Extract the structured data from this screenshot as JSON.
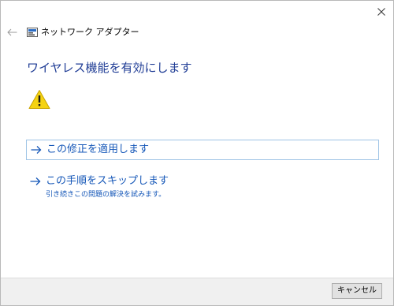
{
  "window": {
    "title": "ネットワーク アダプター"
  },
  "icons": {
    "back": "back-arrow-icon",
    "close": "close-icon",
    "app": "network-adapter-icon",
    "warning": "warning-icon",
    "option_arrow": "right-arrow-icon"
  },
  "main": {
    "heading": "ワイヤレス機能を有効にします"
  },
  "options": [
    {
      "label": "この修正を適用します",
      "description": ""
    },
    {
      "label": "この手順をスキップします",
      "description": "引き続きこの問題の解決を試みます。"
    }
  ],
  "footer": {
    "cancel_label": "キャンセル"
  },
  "colors": {
    "heading": "#1f3c95",
    "link": "#1557b8",
    "focus_border": "#9fc4e6",
    "footer_bg": "#f0f0f0",
    "warning_fill": "#f5d313"
  }
}
